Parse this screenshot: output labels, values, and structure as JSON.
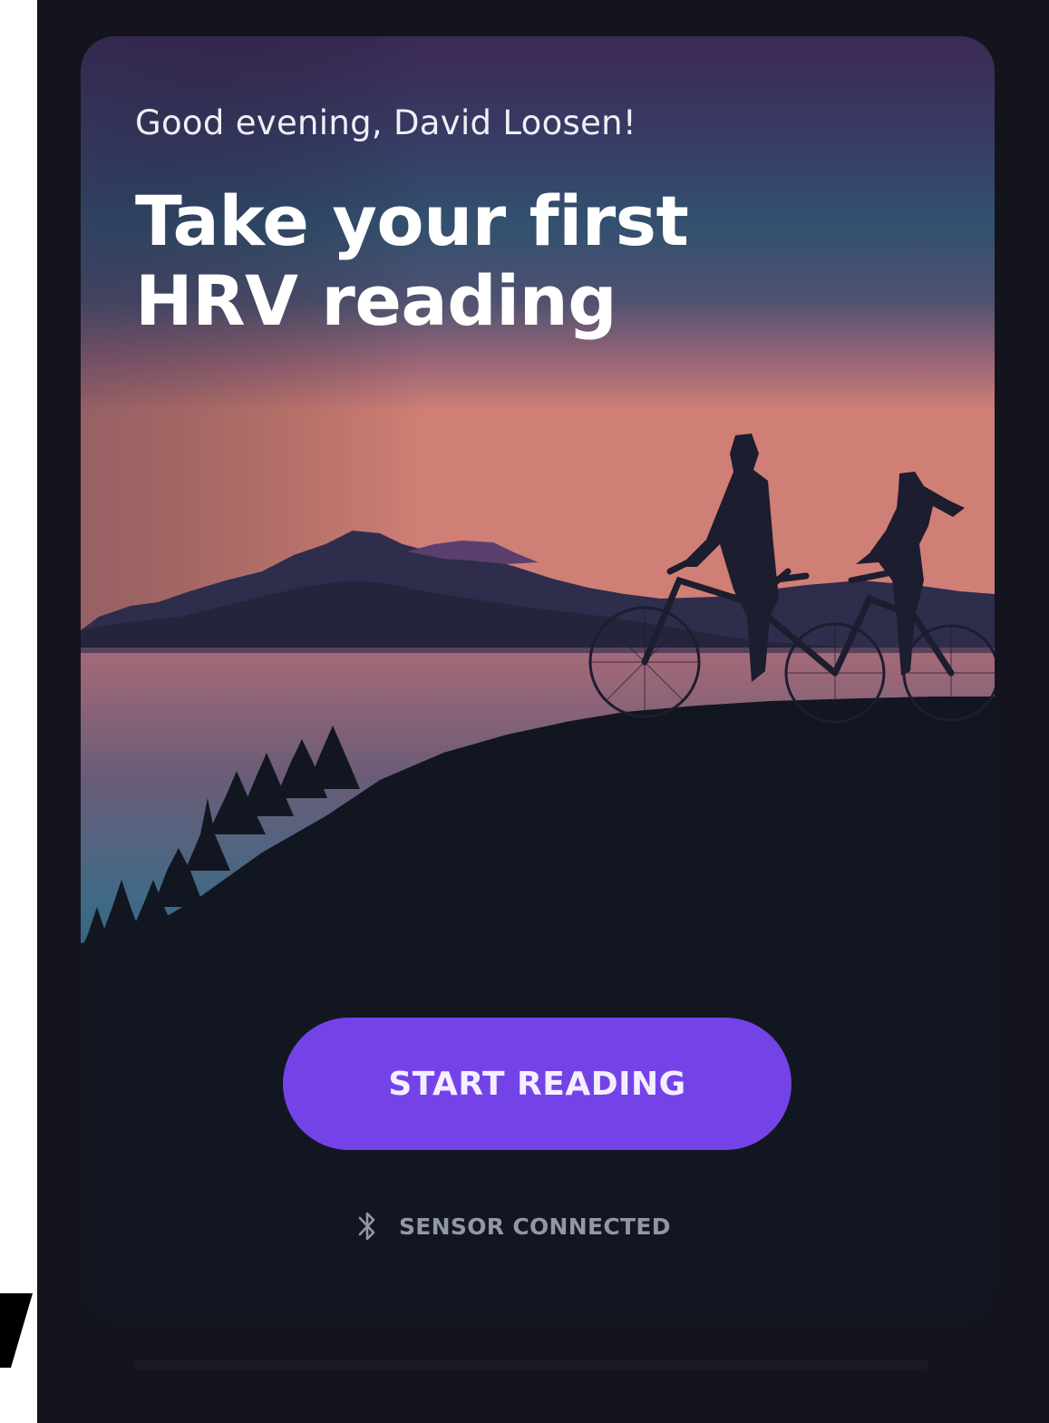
{
  "app": {
    "greeting": "Good evening, David Loosen!",
    "headline_line1": "Take your first",
    "headline_line2": "HRV reading"
  },
  "actions": {
    "start_label": "START READING"
  },
  "sensor": {
    "status_label": "SENSOR CONNECTED",
    "icon": "bluetooth-icon"
  },
  "colors": {
    "accent": "#7443e8",
    "background": "#14141e",
    "status_text": "#9297a8"
  }
}
